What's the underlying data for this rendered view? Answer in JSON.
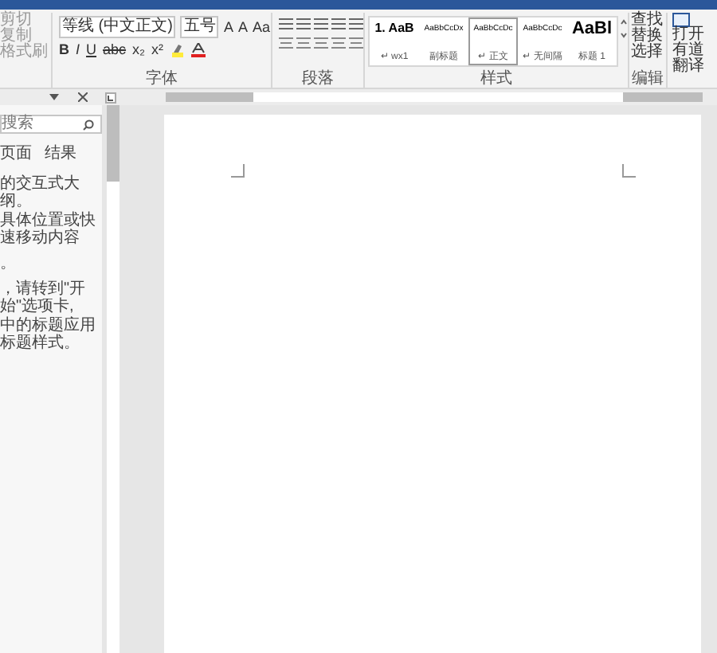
{
  "clipboard": {
    "items": [
      "剪切",
      "复制",
      "格式刷"
    ]
  },
  "font": {
    "family": "等线 (中文正文)",
    "size": "五号",
    "row1_glyphs": [
      "A",
      "A",
      "Aa"
    ],
    "row2_glyphs": [
      "B",
      "I",
      "U",
      "abc",
      "x₂",
      "x²"
    ],
    "label": "字体"
  },
  "paragraph": {
    "label": "段落"
  },
  "styles": {
    "items": [
      {
        "sample": "1. AaB",
        "name": "↵ wx1",
        "selected": false,
        "kind": "numbered"
      },
      {
        "sample": "AaBbCcDx",
        "name": "副标题",
        "selected": false,
        "kind": "small"
      },
      {
        "sample": "AaBbCcDc",
        "name": "↵ 正文",
        "selected": true,
        "kind": "small"
      },
      {
        "sample": "AaBbCcDc",
        "name": "↵ 无间隔",
        "selected": false,
        "kind": "small"
      },
      {
        "sample": "AaBl",
        "name": "标题 1",
        "selected": false,
        "kind": "heading"
      }
    ],
    "label": "样式"
  },
  "editing": {
    "items": [
      "查找",
      "替换",
      "选择"
    ],
    "label": "编辑"
  },
  "translate": {
    "lines": [
      "打开",
      "有道翻译"
    ]
  },
  "nav_pane": {
    "search_placeholder": "搜索",
    "tabs": [
      {
        "label": "页面",
        "selected": false
      },
      {
        "label": "结果",
        "selected": false
      }
    ],
    "lines": [
      "的交互式大纲。",
      "具体位置或快速移动内容",
      "。",
      "，请转到\"开始\"选项卡,",
      "中的标题应用标题样式。"
    ]
  }
}
